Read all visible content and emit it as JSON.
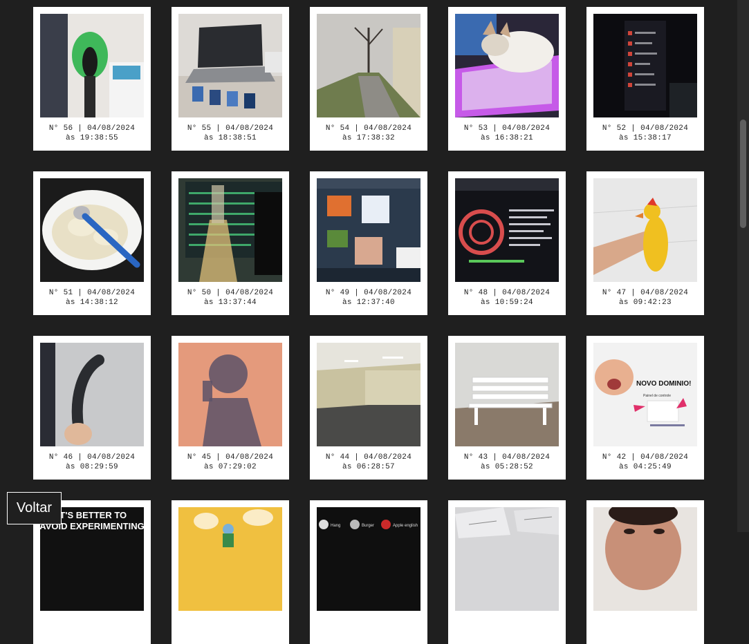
{
  "gallery": {
    "cards": [
      {
        "number": "N° 56 | 04/08/2024",
        "time": "às 19:38:55",
        "photo": "green-plush-photo",
        "bg": "#e9e6e2",
        "accent": "#3fb85a"
      },
      {
        "number": "N° 55 | 04/08/2024",
        "time": "às 18:38:51",
        "photo": "laptop-photo",
        "bg": "#dddad6",
        "accent": "#4a4c52"
      },
      {
        "number": "N° 54 | 04/08/2024",
        "time": "às 17:38:32",
        "photo": "street-photo",
        "bg": "#c9c7c3",
        "accent": "#6f7c4e"
      },
      {
        "number": "N° 53 | 04/08/2024",
        "time": "às 16:38:21",
        "photo": "cat-keyboard-photo",
        "bg": "#2a2638",
        "accent": "#c65ae8"
      },
      {
        "number": "N° 52 | 04/08/2024",
        "time": "às 15:38:17",
        "photo": "dark-screen-photo",
        "bg": "#0c0c10",
        "accent": "#d0453a"
      },
      {
        "number": "N° 51 | 04/08/2024",
        "time": "às 14:38:12",
        "photo": "plate-photo",
        "bg": "#1b1b1b",
        "accent": "#2a66c2"
      },
      {
        "number": "N° 50 | 04/08/2024",
        "time": "às 13:37:44",
        "photo": "bottle-screen-photo",
        "bg": "#2f3a34",
        "accent": "#e0c07a"
      },
      {
        "number": "N° 49 | 04/08/2024",
        "time": "às 12:37:40",
        "photo": "monitor-photo",
        "bg": "#2b3a4c",
        "accent": "#e07030"
      },
      {
        "number": "N° 48 | 04/08/2024",
        "time": "às 10:59:24",
        "photo": "terminal-photo",
        "bg": "#121318",
        "accent": "#d84d4d"
      },
      {
        "number": "N° 47 | 04/08/2024",
        "time": "às 09:42:23",
        "photo": "rubber-chicken-photo",
        "bg": "#e8e8e8",
        "accent": "#f0c020"
      },
      {
        "number": "N° 46 | 04/08/2024",
        "time": "às 08:29:59",
        "photo": "black-tube-photo",
        "bg": "#c8c9cb",
        "accent": "#2a2c30"
      },
      {
        "number": "N° 45 | 04/08/2024",
        "time": "às 07:29:02",
        "photo": "shadow-photo",
        "bg": "#e49a7c",
        "accent": "#5d5268"
      },
      {
        "number": "N° 44 | 04/08/2024",
        "time": "às 06:28:57",
        "photo": "empty-room-photo",
        "bg": "#c9c2a0",
        "accent": "#4a4a48"
      },
      {
        "number": "N° 43 | 04/08/2024",
        "time": "às 05:28:52",
        "photo": "bench-photo",
        "bg": "#d9d9d6",
        "accent": "#8a7a6a"
      },
      {
        "number": "N° 42 | 04/08/2024",
        "time": "às 04:25:49",
        "photo": "meme-domain-photo",
        "bg": "#f2f2f2",
        "accent": "#e0306a"
      },
      {
        "number": "",
        "time": "",
        "photo": "text-poster-photo",
        "bg": "#111111",
        "accent": "#ffffff",
        "text": "IT'S BETTER TO AVOID EXPERIMENTING"
      },
      {
        "number": "",
        "time": "",
        "photo": "cartoon-photo",
        "bg": "#f0c040",
        "accent": "#7ab0d8"
      },
      {
        "number": "",
        "time": "",
        "photo": "app-list-photo",
        "bg": "#0f0f0f",
        "accent": "#cc2a2a",
        "labels": [
          "Hang",
          "Burger",
          "Apple english"
        ]
      },
      {
        "number": "",
        "time": "",
        "photo": "papers-photo",
        "bg": "#d6d6d8",
        "accent": "#888888"
      },
      {
        "number": "",
        "time": "",
        "photo": "face-photo",
        "bg": "#e8e4e0",
        "accent": "#c89078"
      }
    ],
    "meme_caption": "NOVO DOMINIO!",
    "meme_sub": "Painel de controle"
  },
  "nav": {
    "back_label": "Voltar"
  }
}
